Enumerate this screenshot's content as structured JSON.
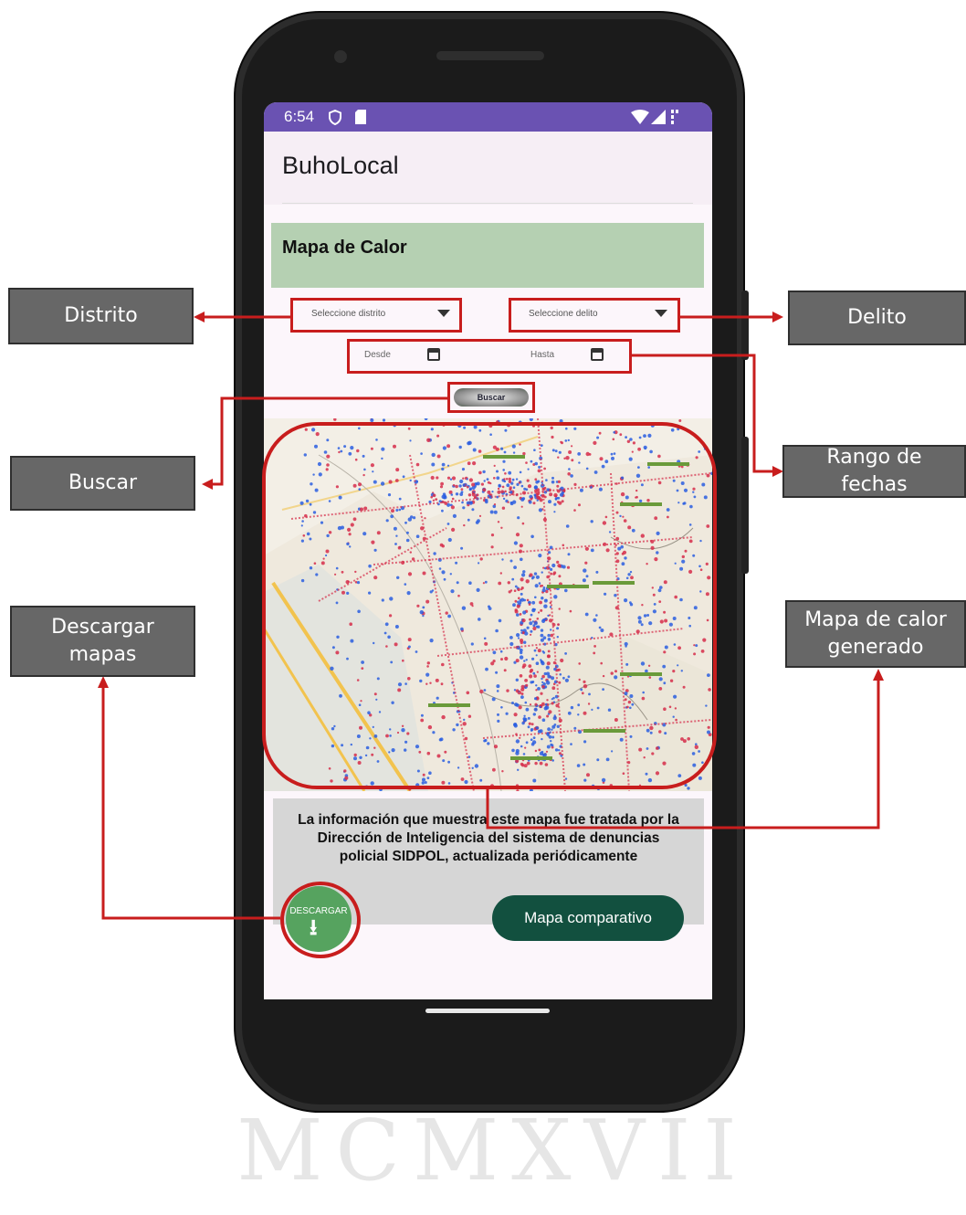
{
  "status_bar": {
    "time": "6:54"
  },
  "app": {
    "title": "BuhoLocal"
  },
  "panel": {
    "title": "Mapa de Calor"
  },
  "filters": {
    "district_placeholder": "Seleccione distrito",
    "crime_placeholder": "Seleccione delito",
    "date_from": "Desde",
    "date_to": "Hasta",
    "search_label": "Buscar"
  },
  "info": {
    "text": "La información que muestra este mapa fue tratada por la Dirección de Inteligencia del sistema de denuncias policial SIDPOL, actualizada periódicamente"
  },
  "actions": {
    "download_label": "DESCARGAR",
    "compare_label": "Mapa comparativo"
  },
  "callouts": {
    "distrito": "Distrito",
    "delito": "Delito",
    "buscar": "Buscar",
    "rango_fechas": "Rango de fechas",
    "descargar_mapas": "Descargar mapas",
    "mapa_generado": "Mapa de calor generado"
  },
  "watermark": "MCMXVII",
  "colors": {
    "status_bar": "#6a52b2",
    "panel_header": "#b5d0b2",
    "compare_button": "#12503f",
    "download_button": "#56a35f",
    "highlight": "#c81d1d",
    "callout_bg": "#676767",
    "heat_red": "#d62d4a",
    "heat_blue": "#2a5ee0"
  },
  "icons": [
    "shield-icon",
    "sd-card-icon",
    "wifi-icon",
    "signal-icon",
    "calendar-icon",
    "dropdown-caret-icon",
    "download-icon"
  ]
}
